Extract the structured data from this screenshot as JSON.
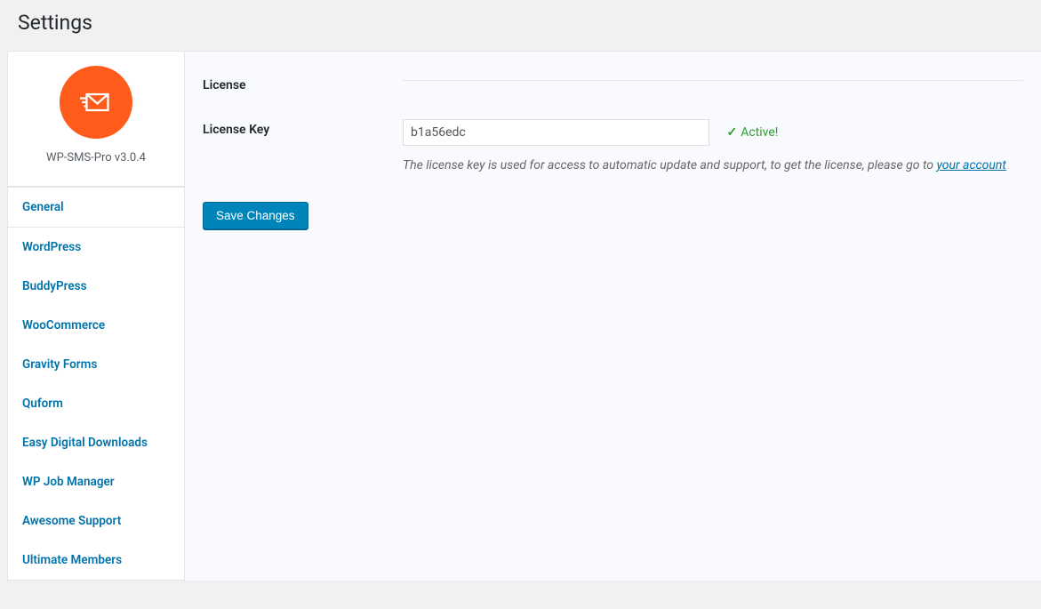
{
  "page": {
    "title": "Settings"
  },
  "plugin": {
    "name": "WP-SMS-Pro v3.0.4"
  },
  "tabs": [
    {
      "label": "General"
    },
    {
      "label": "WordPress"
    },
    {
      "label": "BuddyPress"
    },
    {
      "label": "WooCommerce"
    },
    {
      "label": "Gravity Forms"
    },
    {
      "label": "Quform"
    },
    {
      "label": "Easy Digital Downloads"
    },
    {
      "label": "WP Job Manager"
    },
    {
      "label": "Awesome Support"
    },
    {
      "label": "Ultimate Members"
    }
  ],
  "form": {
    "section_heading": "License",
    "license_key": {
      "label": "License Key",
      "value": "b1a56edc",
      "status": "Active!",
      "help_prefix": "The license key is used for access to automatic update and support, to get the license, please go to ",
      "help_link_text": "your account"
    },
    "submit_label": "Save Changes"
  }
}
